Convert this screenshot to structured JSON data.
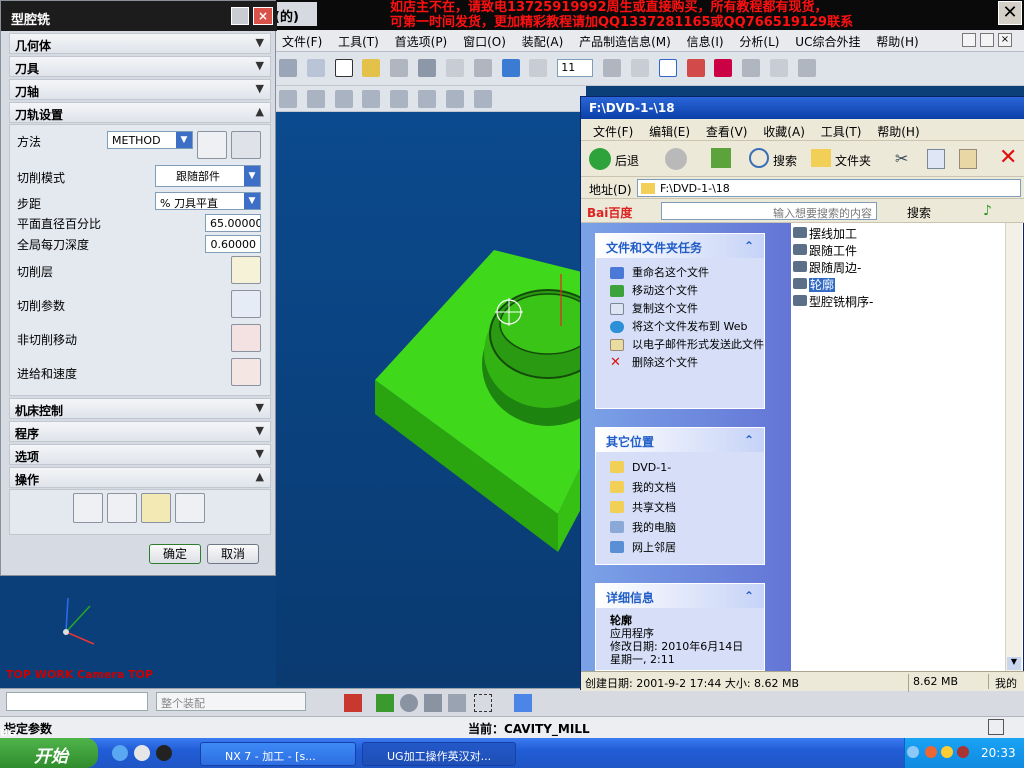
{
  "overlay": {
    "ad_line1": "如店主不在，请致电13725919992周生或直接购买，所有教程都有现货，",
    "ad_line2": "可第一时间发货，更加精彩教程请加QQ1337281165或QQ766519129联系",
    "title_fragment": "(的)",
    "close_glyph": "✕"
  },
  "nx": {
    "menu": [
      "文件(F)",
      "工具(T)",
      "首选项(P)",
      "窗口(O)",
      "装配(A)",
      "产品制造信息(M)",
      "信息(I)",
      "分析(L)",
      "UC综合外挂",
      "帮助(H)"
    ],
    "toolbar_number": "11",
    "viewport_label": "TOP WORK Camera TOP",
    "status_prompt": "指定参数",
    "status_current": "当前：CAVITY_MILL",
    "filter_combo": "整个装配",
    "corner_label": "UG",
    "corner_label2": "11"
  },
  "dialog": {
    "title": "型腔铣",
    "sections": {
      "geometry": "几何体",
      "tool": "刀具",
      "tool_axis": "刀轴",
      "path_settings": "刀轨设置",
      "machine_control": "机床控制",
      "program": "程序",
      "options": "选项",
      "actions": "操作"
    },
    "method_label": "方法",
    "method_value": "METHOD",
    "cut_pattern_label": "切削模式",
    "cut_pattern_value": "跟随部件",
    "stepover_label": "步距",
    "stepover_value": "% 刀具平直",
    "percent_label": "平面直径百分比",
    "percent_value": "65.00000",
    "depth_label": "全局每刀深度",
    "depth_value": "0.60000",
    "levels_label": "切削层",
    "cut_params_label": "切削参数",
    "noncut_label": "非切削移动",
    "feeds_label": "进给和速度",
    "ok": "确定",
    "cancel": "取消"
  },
  "explorer": {
    "title": "F:\\DVD-1-\\18",
    "menu": [
      "文件(F)",
      "编辑(E)",
      "查看(V)",
      "收藏(A)",
      "工具(T)",
      "帮助(H)"
    ],
    "back": "后退",
    "search": "搜索",
    "folders": "文件夹",
    "address_label": "地址(D)",
    "address_value": "F:\\DVD-1-\\18",
    "baidu": "Bai百度",
    "baidu_placeholder": "输入想要搜索的内容",
    "baidu_search": "搜索",
    "tasks_title": "文件和文件夹任务",
    "tasks": [
      "重命名这个文件",
      "移动这个文件",
      "复制这个文件",
      "将这个文件发布到 Web",
      "以电子邮件形式发送此文件",
      "删除这个文件"
    ],
    "other_title": "其它位置",
    "other": [
      "DVD-1-",
      "我的文档",
      "共享文档",
      "我的电脑",
      "网上邻居"
    ],
    "details_title": "详细信息",
    "details_name": "轮廓",
    "details_type": "应用程序",
    "details_date": "修改日期: 2010年6月14日",
    "details_time": "星期一, 2:11",
    "files": [
      "摆线加工",
      "跟随工件",
      "跟随周边-",
      "轮廓",
      "型腔铣桐序-"
    ],
    "status_created": "创建日期: 2001-9-2 17:44 大小: 8.62 MB",
    "status_size": "8.62 MB",
    "status_loc": "我的"
  },
  "taskbar": {
    "start": "开始",
    "task1": "NX 7 - 加工 - [s...",
    "task2": "UG加工操作英汉对...",
    "clock": "20:33"
  },
  "colors": {
    "accent": "#215dd6",
    "ad_red": "#ff1010",
    "model_green": "#44e11e"
  }
}
